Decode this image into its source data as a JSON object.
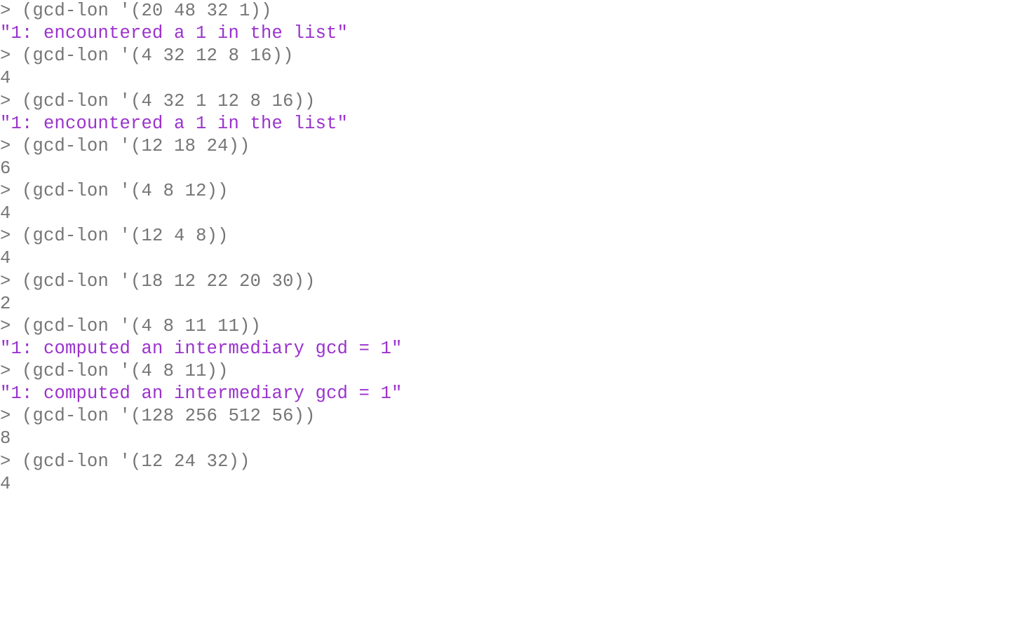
{
  "repl": {
    "lines": [
      {
        "type": "prompt",
        "prompt": ">",
        "input": "(gcd-lon '(20 48 32 1))"
      },
      {
        "type": "string",
        "text": "\"1: encountered a 1 in the list\""
      },
      {
        "type": "prompt",
        "prompt": ">",
        "input": "(gcd-lon '(4 32 12 8 16))"
      },
      {
        "type": "output",
        "text": "4"
      },
      {
        "type": "prompt",
        "prompt": ">",
        "input": "(gcd-lon '(4 32 1 12 8 16))"
      },
      {
        "type": "string",
        "text": "\"1: encountered a 1 in the list\""
      },
      {
        "type": "prompt",
        "prompt": ">",
        "input": "(gcd-lon '(12 18 24))"
      },
      {
        "type": "output",
        "text": "6"
      },
      {
        "type": "prompt",
        "prompt": ">",
        "input": "(gcd-lon '(4 8 12))"
      },
      {
        "type": "output",
        "text": "4"
      },
      {
        "type": "prompt",
        "prompt": ">",
        "input": "(gcd-lon '(12 4 8))"
      },
      {
        "type": "output",
        "text": "4"
      },
      {
        "type": "prompt",
        "prompt": ">",
        "input": "(gcd-lon '(18 12 22 20 30))"
      },
      {
        "type": "output",
        "text": "2"
      },
      {
        "type": "prompt",
        "prompt": ">",
        "input": "(gcd-lon '(4 8 11 11))"
      },
      {
        "type": "string",
        "text": "\"1: computed an intermediary gcd = 1\""
      },
      {
        "type": "prompt",
        "prompt": ">",
        "input": "(gcd-lon '(4 8 11))"
      },
      {
        "type": "string",
        "text": "\"1: computed an intermediary gcd = 1\""
      },
      {
        "type": "prompt",
        "prompt": ">",
        "input": "(gcd-lon '(128 256 512 56))"
      },
      {
        "type": "output",
        "text": "8"
      },
      {
        "type": "prompt",
        "prompt": ">",
        "input": "(gcd-lon '(12 24 32))"
      },
      {
        "type": "output",
        "text": "4"
      }
    ]
  }
}
